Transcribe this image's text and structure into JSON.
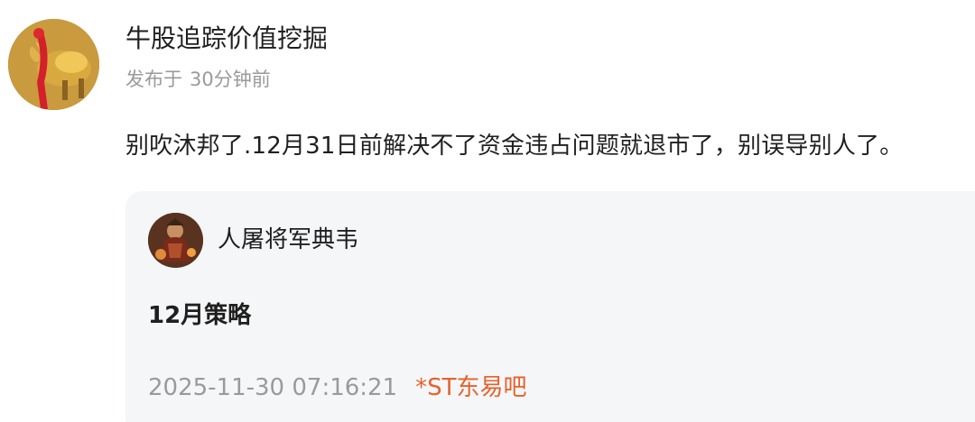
{
  "post": {
    "author": "牛股追踪价值挖掘",
    "published_prefix": "发布于",
    "published_time": "30分钟前",
    "text": "别吹沐邦了.12月31日前解决不了资金违占问题就退市了，别误导别人了。"
  },
  "quoted": {
    "author": "人屠将军典韦",
    "title": "12月策略",
    "datetime": "2025-11-30 07:16:21",
    "forum": "*ST东易吧"
  },
  "colors": {
    "text": "#1f1f1f",
    "meta": "#9a9a9a",
    "card_bg": "#f5f6f8",
    "forum_link": "#e5622c"
  },
  "icons": {
    "author_avatar": "golden-bull-avatar",
    "quoted_avatar": "warrior-avatar"
  }
}
